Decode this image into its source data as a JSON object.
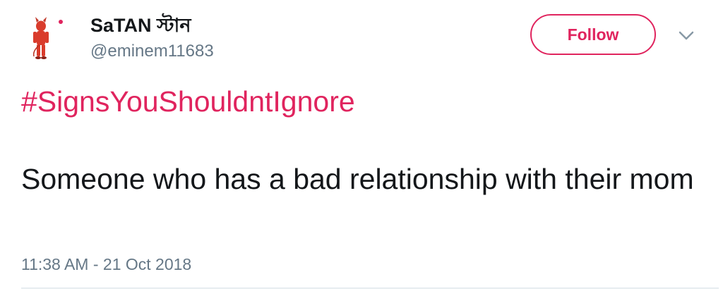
{
  "author": {
    "name": "SaTAN স্টান",
    "handle": "@eminem11683"
  },
  "follow_button": {
    "label": "Follow"
  },
  "tweet": {
    "hashtag": "#SignsYouShouldntIgnore",
    "text": "Someone who has a bad relationship with their mom",
    "timestamp": "11:38 AM - 21 Oct 2018"
  },
  "colors": {
    "accent": "#e0245e",
    "text": "#14171a",
    "secondary": "#657786"
  },
  "icons": {
    "avatar": "devil-figure-avatar",
    "more": "chevron-down-icon"
  }
}
